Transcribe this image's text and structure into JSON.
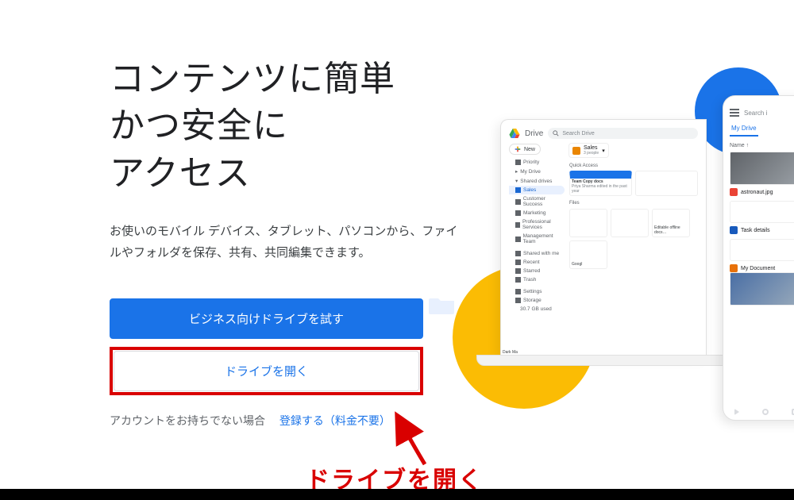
{
  "hero": {
    "title_l1": "コンテンツに簡単",
    "title_l2": "かつ安全に",
    "title_l3": "アクセス",
    "subtitle": "お使いのモバイル デバイス、タブレット、パソコンから、ファイルやフォルダを保存、共有、共同編集できます。"
  },
  "buttons": {
    "primary": "ビジネス向けドライブを試す",
    "secondary": "ドライブを開く"
  },
  "signup": {
    "prompt": "アカウントをお持ちでない場合",
    "link": "登録する（料金不要）"
  },
  "annotation": {
    "text": "ドライブを開く"
  },
  "laptop": {
    "app": "Drive",
    "search_placeholder": "Search Drive",
    "new": "New",
    "nav": {
      "priority": "Priority",
      "my_drive": "My Drive",
      "shared_drives": "Shared drives",
      "sales": "Sales",
      "customer_success": "Customer Success",
      "marketing": "Marketing",
      "professional_services": "Professional Services",
      "management_team": "Management Team",
      "shared_with_me": "Shared with me",
      "recent": "Recent",
      "starred": "Starred",
      "trash": "Trash",
      "settings": "Settings",
      "storage": "Storage",
      "storage_used": "30.7 GB used"
    },
    "content": {
      "folder_name": "Sales",
      "folder_meta": "3 people",
      "quick_access": "Quick Access",
      "card1_title": "Team Copy docs",
      "card1_sub": "Priya Sharma edited in the past year",
      "card2_title": "Dark Ma",
      "files_h": "Files",
      "file3": "Editable offline docs…",
      "file4": "Googl"
    }
  },
  "phone": {
    "search": "Search i",
    "tab": "My Drive",
    "name_h": "Name",
    "f1": "astronaut.jpg",
    "f2": "Task details",
    "f3": "My Document"
  }
}
